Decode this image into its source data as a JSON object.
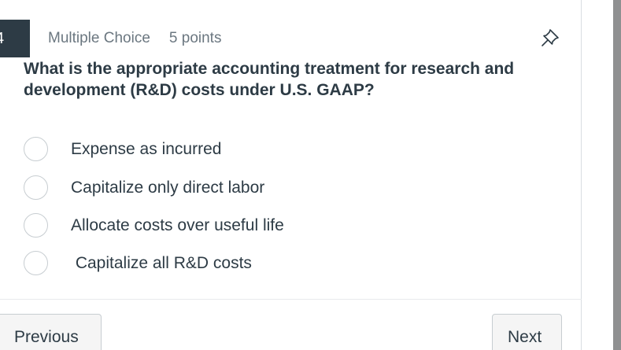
{
  "question": {
    "number": "4",
    "type": "Multiple Choice",
    "points": "5 points",
    "text": "What is the appropriate accounting treatment for research and development (R&D) costs under U.S. GAAP?",
    "options": [
      {
        "label": "Expense as incurred",
        "selected": false
      },
      {
        "label": "Capitalize only direct labor",
        "selected": false
      },
      {
        "label": "Allocate costs over useful life",
        "selected": false
      },
      {
        "label": " Capitalize all R&D costs",
        "selected": false
      }
    ]
  },
  "navigation": {
    "previous_label": "Previous",
    "next_label": "Next"
  },
  "icons": {
    "pin": "pin-icon"
  },
  "colors": {
    "text": "#2d3b45",
    "muted": "#6b7780",
    "badge": "#2d3b45",
    "border": "#c7cdd1",
    "button_bg": "#f5f5f5",
    "scrollbar": "#8f9091"
  }
}
